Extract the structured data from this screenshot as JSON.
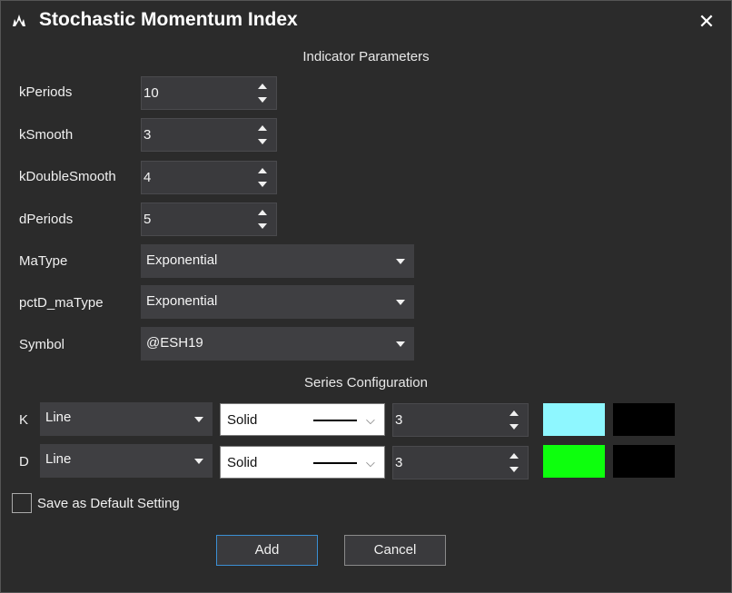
{
  "window": {
    "title": "Stochastic Momentum Index",
    "close_glyph": "✕",
    "icon": "app-logo-icon"
  },
  "sections": {
    "indicator_parameters": "Indicator Parameters",
    "series_configuration": "Series Configuration"
  },
  "params": [
    {
      "label": "kPeriods",
      "value": "10"
    },
    {
      "label": "kSmooth",
      "value": "3"
    },
    {
      "label": "kDoubleSmooth",
      "value": "4"
    },
    {
      "label": "dPeriods",
      "value": "5"
    }
  ],
  "selects": [
    {
      "label": "MaType",
      "value": "Exponential"
    },
    {
      "label": "pctD_maType",
      "value": "Exponential"
    },
    {
      "label": "Symbol",
      "value": "@ESH19"
    }
  ],
  "series": [
    {
      "name": "K",
      "type": "Line",
      "style": "Solid",
      "width": "3",
      "color": "#8ef7ff",
      "second_color": "#000000"
    },
    {
      "name": "D",
      "type": "Line",
      "style": "Solid",
      "width": "3",
      "color": "#0dff0d",
      "second_color": "#000000"
    }
  ],
  "save_default": {
    "label": "Save as Default Setting",
    "checked": false
  },
  "buttons": {
    "add": "Add",
    "cancel": "Cancel"
  }
}
